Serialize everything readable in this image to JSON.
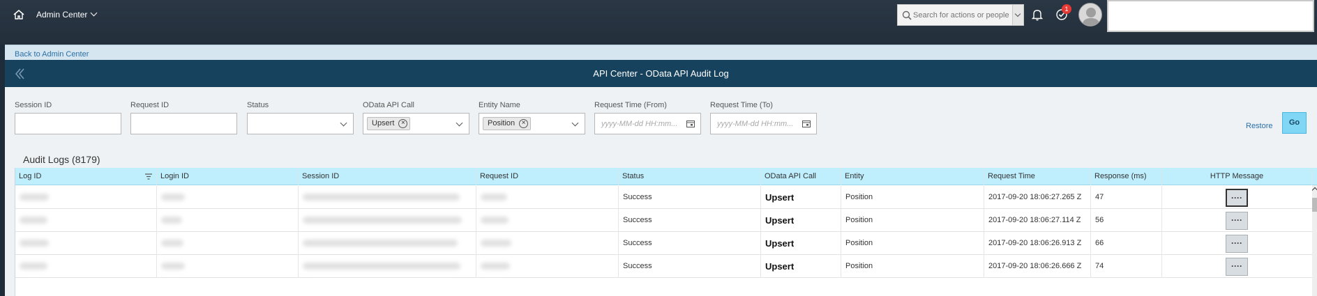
{
  "shell": {
    "title": "Admin Center",
    "search_placeholder": "Search for actions or people",
    "notification_count": "1"
  },
  "page": {
    "back_link": "Back to Admin Center",
    "title": "API Center - OData API Audit Log"
  },
  "filters": {
    "session_id": {
      "label": "Session ID",
      "value": ""
    },
    "request_id": {
      "label": "Request ID",
      "value": ""
    },
    "status": {
      "label": "Status",
      "value": ""
    },
    "odata_call": {
      "label": "OData API Call",
      "token": "Upsert"
    },
    "entity_name": {
      "label": "Entity Name",
      "token": "Position"
    },
    "time_from": {
      "label": "Request Time (From)",
      "placeholder": "yyyy-MM-dd HH:mm..."
    },
    "time_to": {
      "label": "Request Time (To)",
      "placeholder": "yyyy-MM-dd HH:mm..."
    },
    "restore": "Restore",
    "go": "Go"
  },
  "table": {
    "title": "Audit Logs (8179)",
    "headers": [
      "Log ID",
      "Login ID",
      "Session ID",
      "Request ID",
      "Status",
      "OData API Call",
      "Entity",
      "Request Time",
      "Response (ms)",
      "HTTP Message"
    ],
    "rows": [
      {
        "status": "Success",
        "call": "Upsert",
        "entity": "Position",
        "time": "2017-09-20 18:06:27.265 Z",
        "response": "47",
        "http": "····"
      },
      {
        "status": "Success",
        "call": "Upsert",
        "entity": "Position",
        "time": "2017-09-20 18:06:27.114 Z",
        "response": "56",
        "http": "····"
      },
      {
        "status": "Success",
        "call": "Upsert",
        "entity": "Position",
        "time": "2017-09-20 18:06:26.913 Z",
        "response": "66",
        "http": "····"
      },
      {
        "status": "Success",
        "call": "Upsert",
        "entity": "Position",
        "time": "2017-09-20 18:06:26.666 Z",
        "response": "74",
        "http": "····"
      }
    ]
  }
}
